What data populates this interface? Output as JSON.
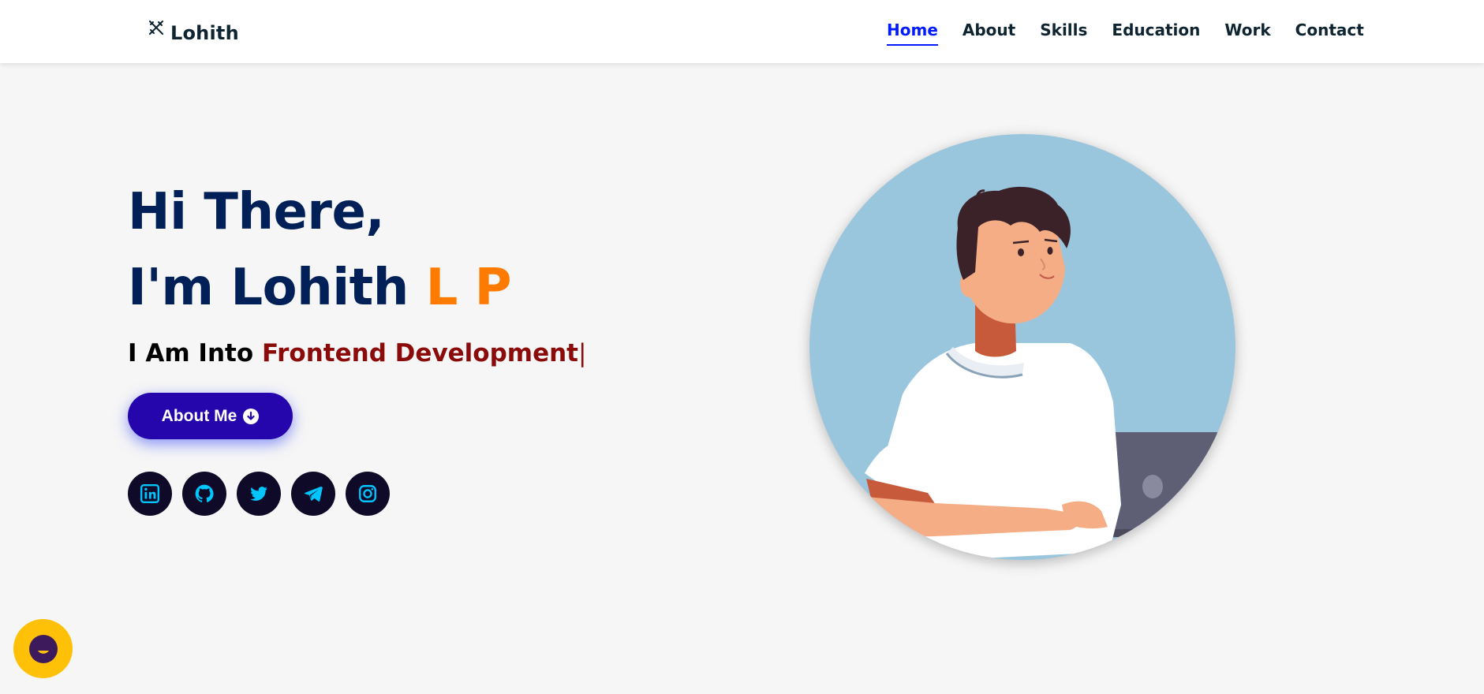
{
  "header": {
    "logo_text": "Lohith",
    "logo_icon": "pencil-ruler-icon",
    "nav": [
      {
        "label": "Home",
        "active": true
      },
      {
        "label": "About",
        "active": false
      },
      {
        "label": "Skills",
        "active": false
      },
      {
        "label": "Education",
        "active": false
      },
      {
        "label": "Work",
        "active": false
      },
      {
        "label": "Contact",
        "active": false
      }
    ]
  },
  "hero": {
    "line1": "Hi There,",
    "line2_prefix": "I'm Lohith ",
    "line2_accent": "L P",
    "typing_prefix": "I Am Into ",
    "typing_value": "Frontend Development",
    "typing_cursor": "|",
    "button_label": "About Me",
    "button_icon": "arrow-down-circle-icon",
    "socials": [
      {
        "name": "linkedin",
        "icon": "linkedin-icon"
      },
      {
        "name": "github",
        "icon": "github-icon"
      },
      {
        "name": "twitter",
        "icon": "twitter-icon"
      },
      {
        "name": "telegram",
        "icon": "telegram-icon"
      },
      {
        "name": "instagram",
        "icon": "instagram-icon"
      }
    ],
    "image": "developer-with-laptop-illustration"
  },
  "chat_widget": {
    "icon": "chat-bubble-icon"
  },
  "colors": {
    "nav_active": "#011aff",
    "title": "#002057",
    "accent": "#ff7b00",
    "typed": "#8b0a0a",
    "button": "#2506ad",
    "social_bg": "#0e0a27",
    "social_icon": "#00c5ff",
    "image_bg": "#9ac6dd",
    "chat_bg": "#ffc107"
  }
}
